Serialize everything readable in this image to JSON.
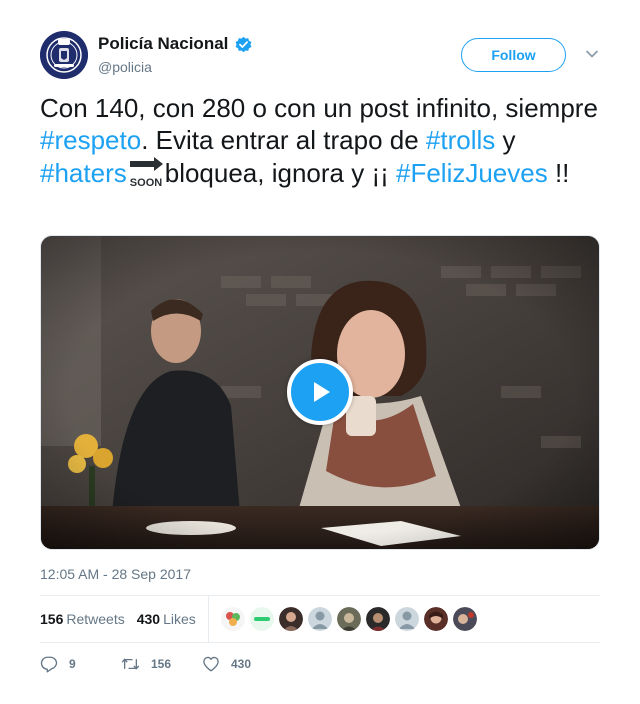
{
  "author": {
    "name": "Policía Nacional",
    "handle": "@policia",
    "verified": true
  },
  "header": {
    "follow_label": "Follow"
  },
  "tweet": {
    "t1": "Con 140, con 280 o con un post infinito, siempre ",
    "h1": "#respeto",
    "t2": ". Evita entrar al trapo de ",
    "h2": "#trolls",
    "t3": " y ",
    "h3": "#haters",
    "t4": "bloquea, ignora y ¡¡ ",
    "h4": "#FelizJueves",
    "t5": " !!",
    "emoji_text": "SOON"
  },
  "media": {
    "type": "video"
  },
  "timestamp": "12:05 AM - 28 Sep 2017",
  "stats": {
    "retweets_count": "156",
    "retweets_label": "Retweets",
    "likes_count": "430",
    "likes_label": "Likes"
  },
  "actions": {
    "reply_count": "9",
    "retweet_count": "156",
    "like_count": "430"
  },
  "colors": {
    "accent": "#1da1f2",
    "text": "#14171a",
    "muted": "#657786"
  }
}
